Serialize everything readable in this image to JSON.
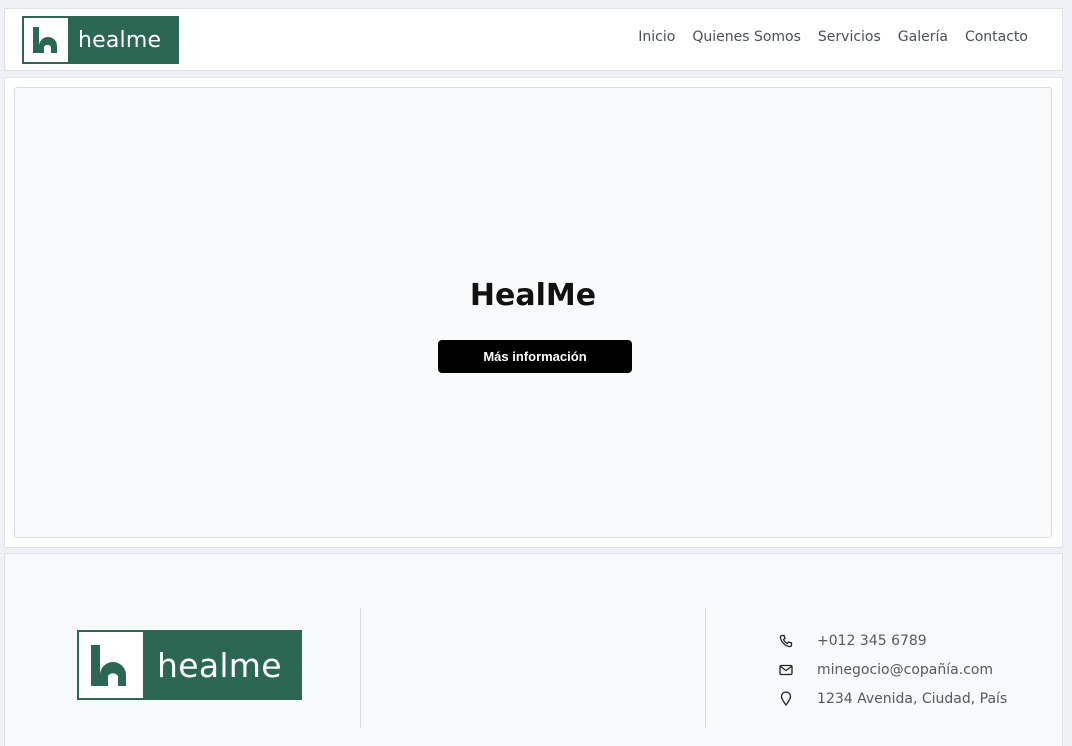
{
  "header": {
    "logo_text": "healme",
    "nav": [
      {
        "label": "Inicio"
      },
      {
        "label": "Quienes Somos"
      },
      {
        "label": "Servicios"
      },
      {
        "label": "Galería"
      },
      {
        "label": "Contacto"
      }
    ]
  },
  "hero": {
    "title": "HealMe",
    "button_label": "Más información"
  },
  "footer": {
    "logo_text": "healme",
    "contact": {
      "phone": "+012 345 6789",
      "email": "minegocio@copañía.com",
      "address": "1234 Avenida, Ciudad, País"
    }
  },
  "colors": {
    "brand": "#2b6752",
    "button": "#000000"
  },
  "icons": [
    "phone-icon",
    "mail-icon",
    "location-pin-icon"
  ]
}
